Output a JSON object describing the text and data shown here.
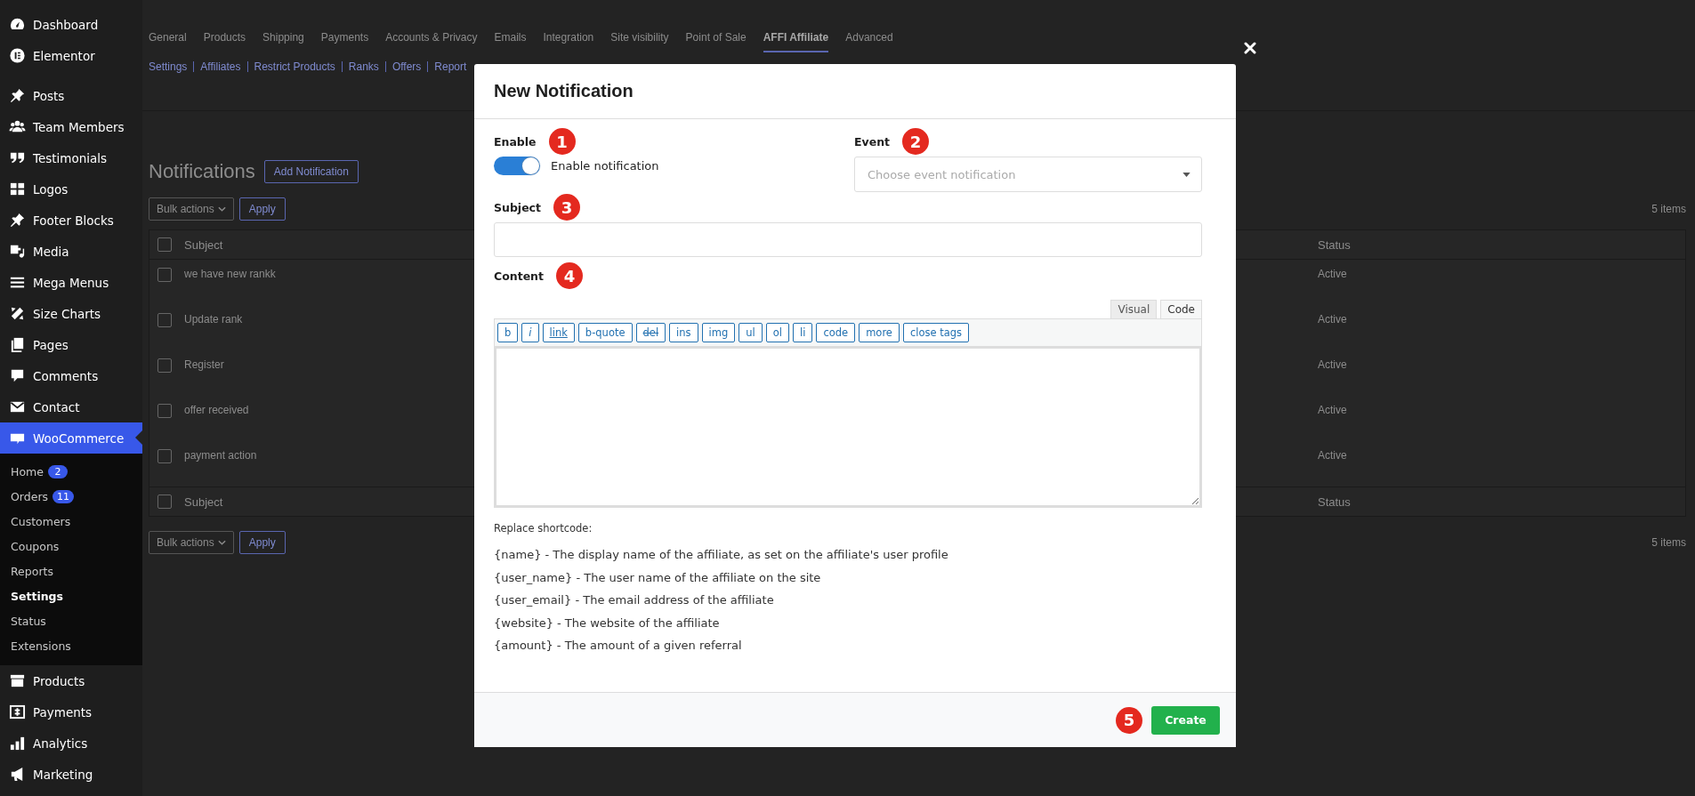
{
  "sidebar": {
    "items": [
      {
        "label": "Dashboard",
        "selected": false
      },
      {
        "label": "Elementor",
        "selected": false
      },
      {
        "label": "Posts",
        "selected": false
      },
      {
        "label": "Team Members",
        "selected": false
      },
      {
        "label": "Testimonials",
        "selected": false
      },
      {
        "label": "Logos",
        "selected": false
      },
      {
        "label": "Footer Blocks",
        "selected": false
      },
      {
        "label": "Media",
        "selected": false
      },
      {
        "label": "Mega Menus",
        "selected": false
      },
      {
        "label": "Size Charts",
        "selected": false
      },
      {
        "label": "Pages",
        "selected": false
      },
      {
        "label": "Comments",
        "selected": false
      },
      {
        "label": "Contact",
        "selected": false
      },
      {
        "label": "WooCommerce",
        "selected": true,
        "children": [
          {
            "label": "Home",
            "badge": "2",
            "selected": false
          },
          {
            "label": "Orders",
            "badge": "11",
            "selected": false
          },
          {
            "label": "Customers",
            "selected": false
          },
          {
            "label": "Coupons",
            "selected": false
          },
          {
            "label": "Reports",
            "selected": false
          },
          {
            "label": "Settings",
            "selected": true
          },
          {
            "label": "Status",
            "selected": false
          },
          {
            "label": "Extensions",
            "selected": false
          }
        ]
      },
      {
        "label": "Products",
        "selected": false
      },
      {
        "label": "Payments",
        "selected": false
      },
      {
        "label": "Analytics",
        "selected": false
      },
      {
        "label": "Marketing",
        "selected": false
      }
    ]
  },
  "tabs": [
    {
      "label": "General",
      "selected": false
    },
    {
      "label": "Products",
      "selected": false
    },
    {
      "label": "Shipping",
      "selected": false
    },
    {
      "label": "Payments",
      "selected": false
    },
    {
      "label": "Accounts & Privacy",
      "selected": false
    },
    {
      "label": "Emails",
      "selected": false
    },
    {
      "label": "Integration",
      "selected": false
    },
    {
      "label": "Site visibility",
      "selected": false
    },
    {
      "label": "Point of Sale",
      "selected": false
    },
    {
      "label": "AFFI Affiliate",
      "selected": true
    },
    {
      "label": "Advanced",
      "selected": false
    }
  ],
  "subnav": [
    "Settings",
    "Affiliates",
    "Restrict Products",
    "Ranks",
    "Offers",
    "Report"
  ],
  "page": {
    "title": "Notifications",
    "add_button": "Add Notification",
    "bulk_actions": "Bulk actions",
    "apply": "Apply",
    "bottom_bulk_actions": "Bulk actions",
    "bottom_apply": "Apply",
    "item_count": "5 items",
    "bottom_item_count": "5 items"
  },
  "table": {
    "header_checked": false,
    "footer_checked": false,
    "columns": [
      "Subject",
      "Status"
    ],
    "footer_columns": [
      "Subject",
      "Status"
    ],
    "rows": [
      {
        "subject": "we have new rankk",
        "status": "Active",
        "checked": false
      },
      {
        "subject": "Update rank",
        "status": "Active",
        "checked": false
      },
      {
        "subject": "Register",
        "status": "Active",
        "checked": false
      },
      {
        "subject": "offer received",
        "status": "Active",
        "checked": false
      },
      {
        "subject": "payment action",
        "status": "Active",
        "checked": false
      }
    ]
  },
  "modal": {
    "title": "New Notification",
    "enable": {
      "label": "Enable",
      "marker": "1",
      "on": true,
      "toggle_label": "Enable notification"
    },
    "event": {
      "label": "Event",
      "marker": "2",
      "placeholder": "Choose event notification"
    },
    "subject": {
      "label": "Subject",
      "marker": "3"
    },
    "content": {
      "label": "Content",
      "marker": "4",
      "editor_tabs": [
        {
          "label": "Visual",
          "selected": false
        },
        {
          "label": "Code",
          "selected": true
        }
      ],
      "quicktags": [
        {
          "label": "b",
          "kind": "plain"
        },
        {
          "label": "i",
          "kind": "italic"
        },
        {
          "label": "link",
          "kind": "underline"
        },
        {
          "label": "b-quote",
          "kind": "plain"
        },
        {
          "label": "del",
          "kind": "strike"
        },
        {
          "label": "ins",
          "kind": "plain"
        },
        {
          "label": "img",
          "kind": "plain"
        },
        {
          "label": "ul",
          "kind": "plain"
        },
        {
          "label": "ol",
          "kind": "plain"
        },
        {
          "label": "li",
          "kind": "plain"
        },
        {
          "label": "code",
          "kind": "plain"
        },
        {
          "label": "more",
          "kind": "plain"
        },
        {
          "label": "close tags",
          "kind": "plain"
        }
      ]
    },
    "shortcode_heading": "Replace shortcode:",
    "shortcodes": [
      "{name} - The display name of the affiliate, as set on the affiliate's user profile",
      "{user_name} - The user name of the affiliate on the site",
      "{user_email} - The email address of the affiliate",
      "{website} - The website of the affiliate",
      "{amount} - The amount of a given referral"
    ],
    "create_marker": "5",
    "create_button": "Create"
  }
}
